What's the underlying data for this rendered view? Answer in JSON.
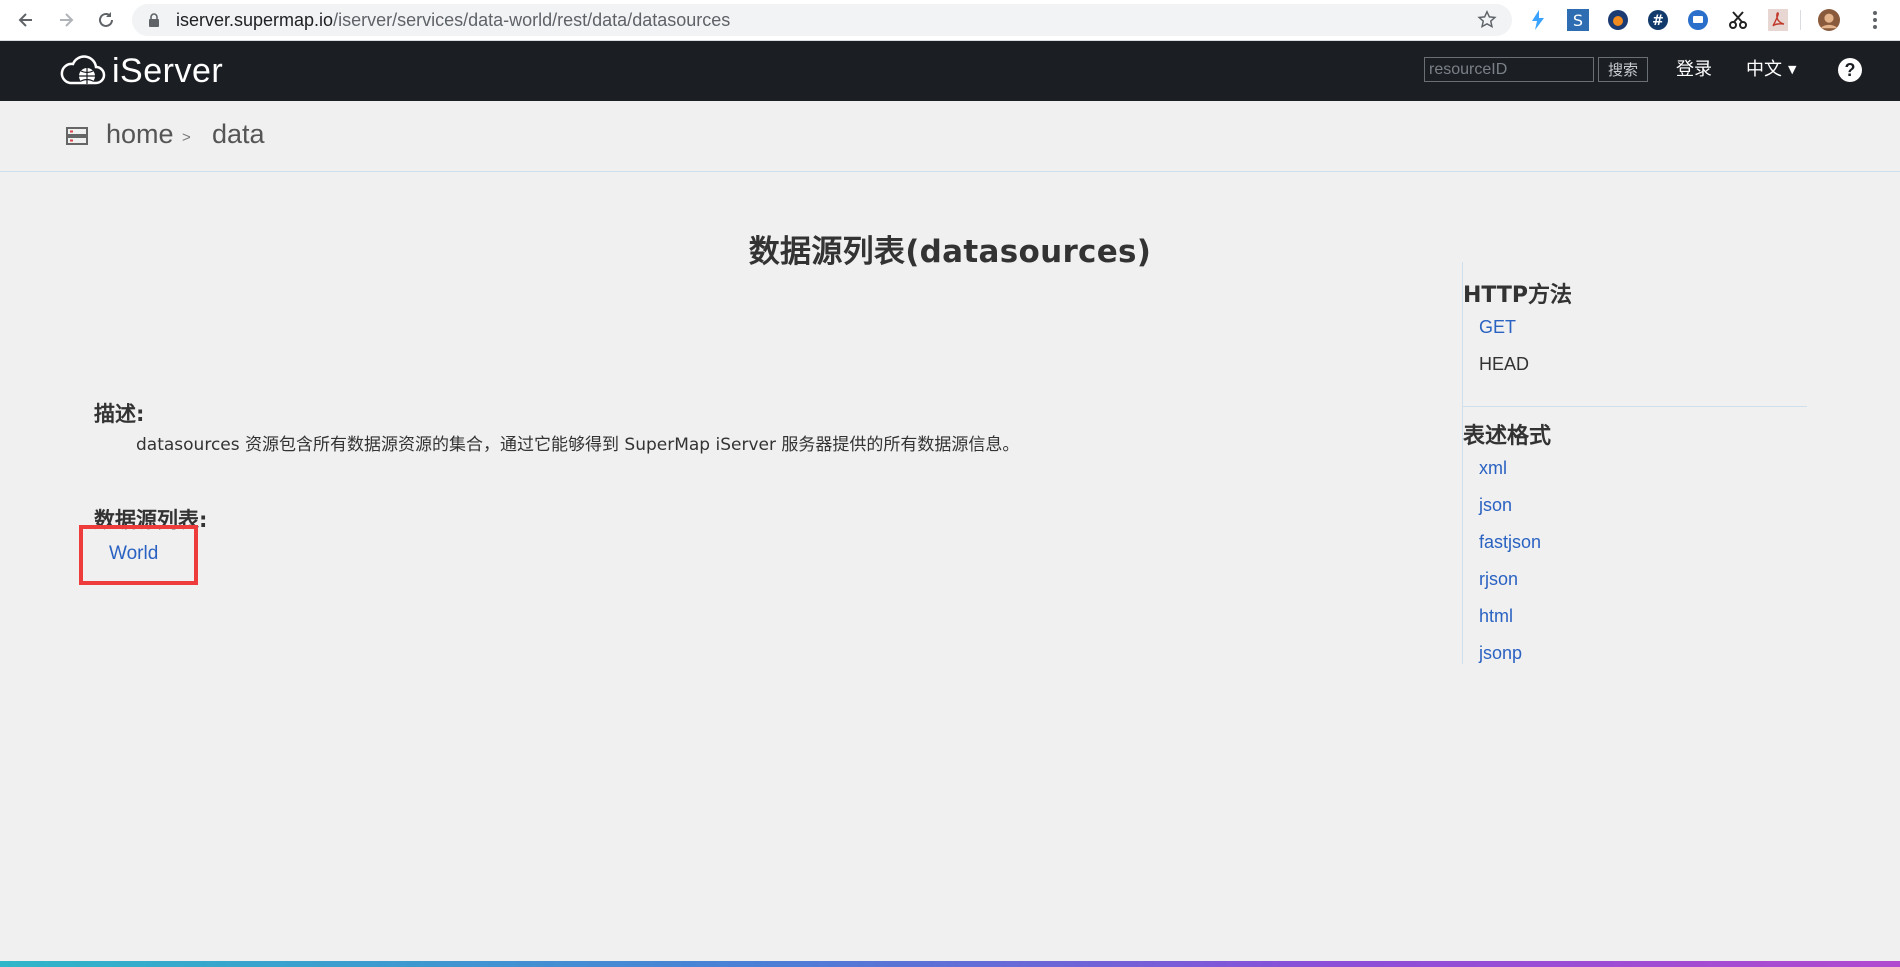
{
  "browser": {
    "url_host": "iserver.supermap.io",
    "url_path": "/iserver/services/data-world/rest/data/datasources"
  },
  "header": {
    "logo_text": "iServer",
    "search_placeholder": "resourceID",
    "search_button": "搜索",
    "login": "登录",
    "language": "中文"
  },
  "breadcrumb": {
    "home": "home",
    "separator": ">",
    "current": "data"
  },
  "main": {
    "title": "数据源列表(datasources)",
    "description_label": "描述:",
    "description_text": "datasources 资源包含所有数据源资源的集合，通过它能够得到 SuperMap iServer 服务器提供的所有数据源信息。",
    "list_label": "数据源列表:",
    "datasources": [
      "World"
    ]
  },
  "side": {
    "http_title": "HTTP方法",
    "http_methods": [
      {
        "label": "GET",
        "link": true
      },
      {
        "label": "HEAD",
        "link": false
      }
    ],
    "format_title": "表述格式",
    "formats": [
      "xml",
      "json",
      "fastjson",
      "rjson",
      "html",
      "jsonp"
    ]
  },
  "colors": {
    "header_bg": "#1b1e23",
    "link": "#2a62c2",
    "highlight": "#ee3b3b"
  }
}
